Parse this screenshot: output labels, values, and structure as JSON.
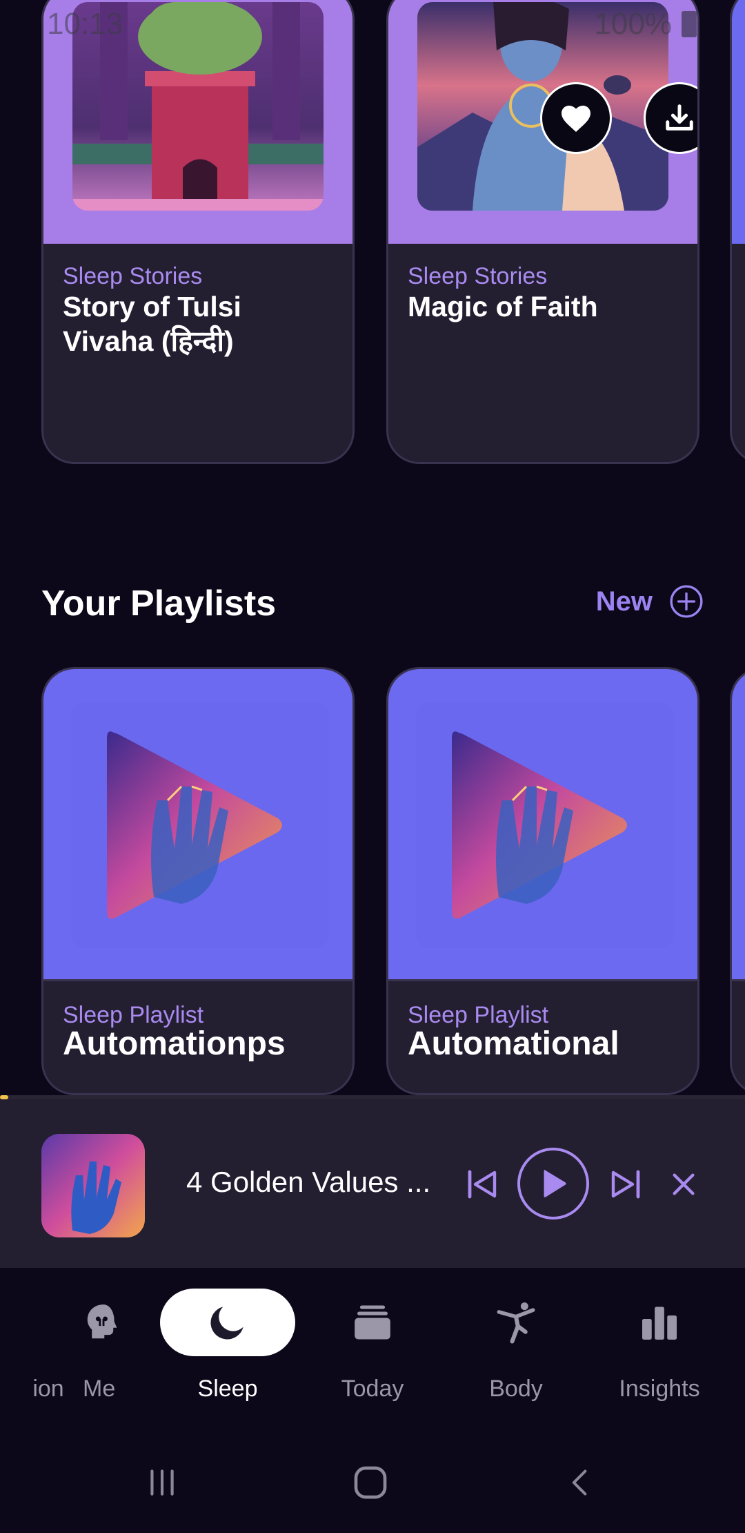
{
  "status_bar": {
    "time": "10:13",
    "left_icons": "⛅ G ⋯",
    "right_icons": "📶",
    "battery": "100%"
  },
  "colors": {
    "background": "#0c0819",
    "card": "#231e30",
    "accent_purple": "#a98bf0",
    "story_art": "#a77de8",
    "playlist_art": "#6c6af0",
    "progress": "#f1c24a"
  },
  "story_cards": [
    {
      "category": "Sleep Stories",
      "title": "Story of Tulsi Vivaha (हिन्दी)"
    },
    {
      "category": "Sleep Stories",
      "title": "Magic of Faith"
    }
  ],
  "card_actions": {
    "favorite_icon": "heart-icon",
    "download_icon": "download-icon"
  },
  "playlists_section": {
    "title": "Your Playlists",
    "new_label": "New",
    "new_icon": "plus-circle-icon"
  },
  "playlist_cards": [
    {
      "category": "Sleep Playlist",
      "title": "Automationps"
    },
    {
      "category": "Sleep Playlist",
      "title": "Automational"
    }
  ],
  "mini_player": {
    "title": "4 Golden Values ...",
    "progress": 0.01,
    "icons": [
      "skip-previous-icon",
      "play-icon",
      "skip-next-icon",
      "close-icon"
    ]
  },
  "bottom_nav": {
    "items": [
      {
        "label": "ion",
        "icon": ""
      },
      {
        "label": "Me",
        "icon": "head-icon"
      },
      {
        "label": "Sleep",
        "icon": "moon-icon",
        "active": true
      },
      {
        "label": "Today",
        "icon": "stack-icon"
      },
      {
        "label": "Body",
        "icon": "yoga-icon"
      },
      {
        "label": "Insights",
        "icon": "bar-chart-icon"
      }
    ]
  },
  "system_nav": {
    "icons": [
      "recents-icon",
      "home-icon",
      "back-icon"
    ]
  }
}
